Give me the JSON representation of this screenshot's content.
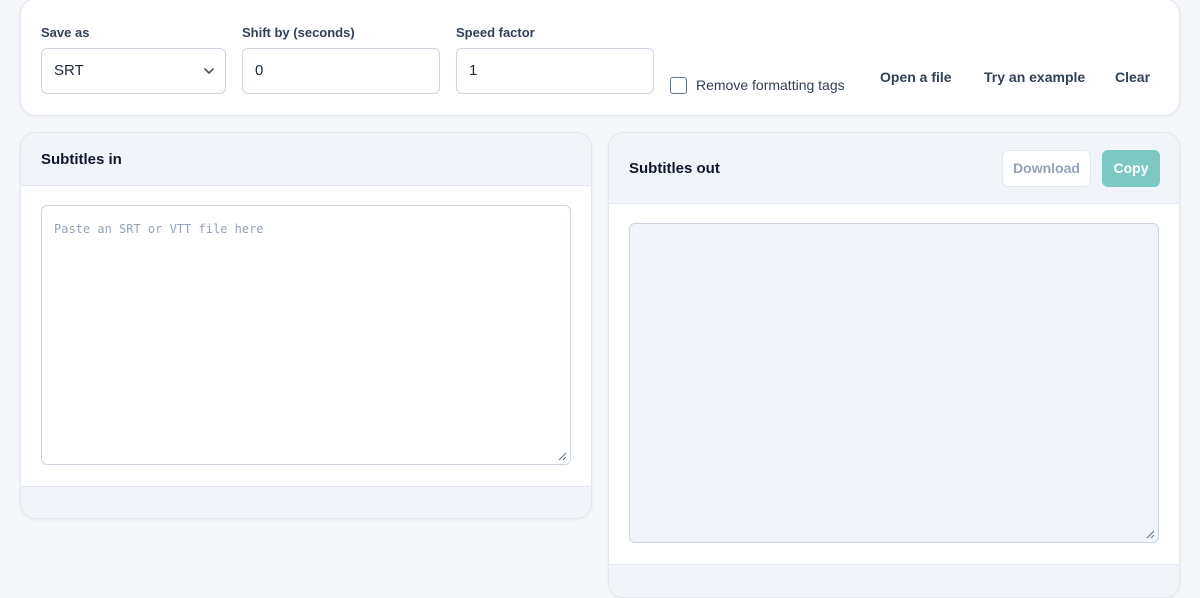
{
  "options": {
    "save_as": {
      "label": "Save as",
      "value": "SRT"
    },
    "shift": {
      "label": "Shift by (seconds)",
      "value": "0"
    },
    "speed": {
      "label": "Speed factor",
      "value": "1"
    },
    "remove_tags": {
      "label": "Remove formatting tags",
      "checked": false
    },
    "open_file": "Open a file",
    "try_example": "Try an example",
    "clear": "Clear"
  },
  "panel_in": {
    "title": "Subtitles in",
    "placeholder": "Paste an SRT or VTT file here"
  },
  "panel_out": {
    "title": "Subtitles out",
    "download": "Download",
    "copy": "Copy"
  },
  "colors": {
    "accent": "#7ec8c3",
    "background": "#f5f7fa",
    "panel_header": "#f1f5f9"
  },
  "icons": {
    "select_arrow": "chevron-down-icon",
    "resize": "resize-grip-icon"
  }
}
